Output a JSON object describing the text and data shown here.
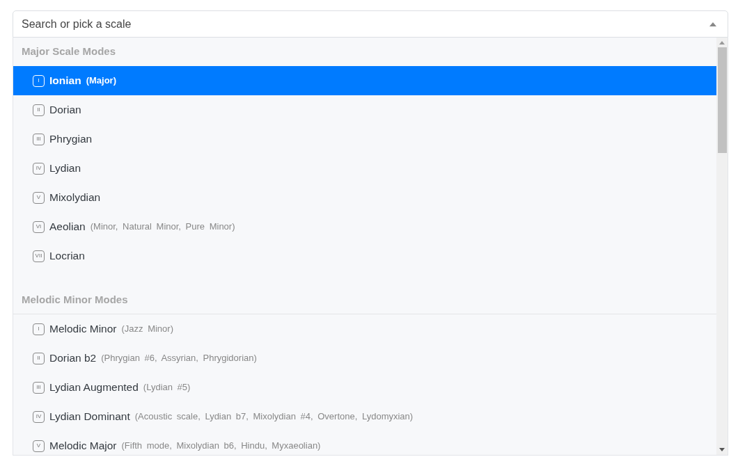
{
  "search": {
    "placeholder": "Search or pick a scale"
  },
  "groups": [
    {
      "title": "Major Scale Modes",
      "items": [
        {
          "numeral": "I",
          "name": "Ionian",
          "aliases": "(Major)",
          "selected": true
        },
        {
          "numeral": "II",
          "name": "Dorian",
          "selected": false
        },
        {
          "numeral": "III",
          "name": "Phrygian",
          "selected": false
        },
        {
          "numeral": "IV",
          "name": "Lydian",
          "selected": false
        },
        {
          "numeral": "V",
          "name": "Mixolydian",
          "selected": false
        },
        {
          "numeral": "VI",
          "name": "Aeolian",
          "aliases": "(Minor, Natural Minor, Pure Minor)",
          "selected": false
        },
        {
          "numeral": "VII",
          "name": "Locrian",
          "selected": false
        }
      ]
    },
    {
      "title": "Melodic Minor Modes",
      "items": [
        {
          "numeral": "I",
          "name": "Melodic Minor",
          "aliases": "(Jazz Minor)",
          "selected": false
        },
        {
          "numeral": "II",
          "name": "Dorian b2",
          "aliases": "(Phrygian #6, Assyrian, Phrygidorian)",
          "selected": false
        },
        {
          "numeral": "III",
          "name": "Lydian Augmented",
          "aliases": "(Lydian #5)",
          "selected": false
        },
        {
          "numeral": "IV",
          "name": "Lydian Dominant",
          "aliases": "(Acoustic scale, Lydian b7, Mixolydian #4, Overtone, Lydomyxian)",
          "selected": false
        },
        {
          "numeral": "V",
          "name": "Melodic Major",
          "aliases": "(Fifth mode, Mixolydian b6, Hindu, Myxaeolian)",
          "selected": false
        }
      ]
    }
  ]
}
